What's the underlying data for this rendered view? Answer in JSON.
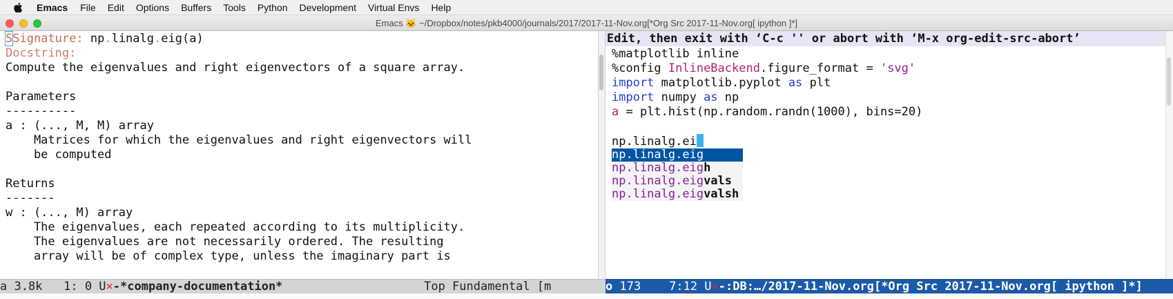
{
  "menubar": {
    "app_name": "Emacs",
    "items": [
      "File",
      "Edit",
      "Options",
      "Buffers",
      "Tools",
      "Python",
      "Development",
      "Virtual Envs",
      "Help"
    ]
  },
  "window": {
    "title": "Emacs 🐱 ~/Dropbox/notes/pkb4000/journals/2017/2017-11-Nov.org[*Org Src 2017-11-Nov.org[ ipython ]*]"
  },
  "left_pane": {
    "signature_label": "Signature:",
    "signature_np": "np",
    "signature_linalg": "linalg",
    "signature_eig": "eig(a)",
    "docstring_label": "Docstring:",
    "lines": [
      "Compute the eigenvalues and right eigenvectors of a square array.",
      "",
      "Parameters",
      "----------",
      "a : (..., M, M) array",
      "    Matrices for which the eigenvalues and right eigenvectors will",
      "    be computed",
      "",
      "Returns",
      "-------",
      "w : (..., M) array",
      "    The eigenvalues, each repeated according to its multiplicity.",
      "    The eigenvalues are not necessarily ordered. The resulting",
      "    array will be of complex type, unless the imaginary part is"
    ]
  },
  "right_pane": {
    "banner": "Edit, then exit with ‘C-c '' or abort with ‘M-x org-edit-src-abort’",
    "code": {
      "line1": "%matplotlib inline",
      "line2_a": "%config ",
      "line2_b": "InlineBackend",
      "line2_c": ".figure_format = ",
      "line2_d": "'svg'",
      "line3_kw": "import",
      "line3_mod": " matplotlib.pyplot ",
      "line3_as": "as",
      "line3_alias": " plt",
      "line4_kw": "import",
      "line4_mod": " numpy ",
      "line4_as": "as",
      "line4_alias": " np",
      "line5_var": "a",
      "line5_rest": " = plt.hist(np.random.randn(1000), bins=20)",
      "line7": "np.linalg.ei"
    },
    "completions": [
      {
        "prefix": "np.linalg.eig",
        "suffix": ""
      },
      {
        "prefix": "np.linalg.eig",
        "suffix": "h"
      },
      {
        "prefix": "np.linalg.eig",
        "suffix": "vals"
      },
      {
        "prefix": "np.linalg.eig",
        "suffix": "valsh"
      }
    ]
  },
  "modeline_left": {
    "state": "a 3.8k   1: 0 U",
    "mark": "×",
    "buffer": "-*company-documentation*",
    "position": "Top Fundamental [",
    "overlap": "m"
  },
  "modeline_right": {
    "lead": "o",
    "info": " 173    7:12 U",
    "mark": "×",
    "rest": "-:DB:…/2017-11-Nov.org[*Org Src 2017-11-Nov.org[ ipython ]*]"
  }
}
